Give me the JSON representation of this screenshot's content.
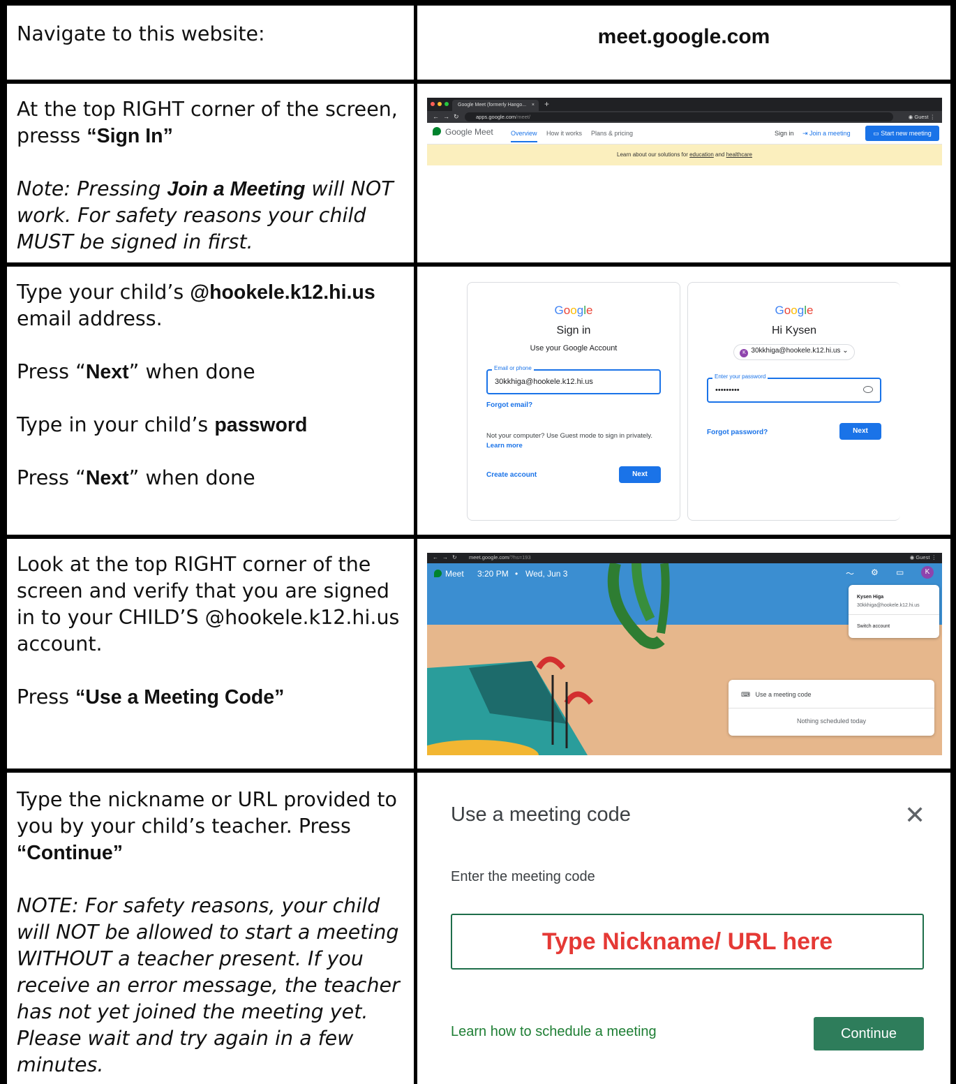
{
  "rows": [
    {
      "left": {
        "line1": "Navigate to this website:"
      },
      "right": {
        "url": "meet.google.com"
      }
    },
    {
      "left": {
        "p1_a": "At the top RIGHT corner of the screen, presss ",
        "p1_b": "“Sign In”",
        "note_a": "Note: Pressing ",
        "note_b": "Join a Meeting",
        "note_c": " will NOT work. For safety reasons your child MUST be signed in first."
      },
      "right": {
        "tab_title": "Google Meet (formerly Hango...",
        "tab_close": "×",
        "new_tab": "+",
        "url_host": "apps.google.com",
        "url_path": "/meet/",
        "guest": "Guest",
        "product": "Google Meet",
        "nav": [
          "Overview",
          "How it works",
          "Plans & pricing"
        ],
        "sign_in": "Sign in",
        "join": "Join a meeting",
        "start": "Start new meeting",
        "banner_a": "Learn about our solutions for ",
        "banner_b": "education",
        "banner_c": " and ",
        "banner_d": "healthcare"
      }
    },
    {
      "left": {
        "p1_a": "Type your child’s ",
        "p1_b": "@hookele.k12.hi.us",
        "p1_c": " email address.",
        "p2_a": "Press “",
        "p2_b": "Next",
        "p2_c": "” when done",
        "p3_a": "Type in your child’s ",
        "p3_b": "password",
        "p4_a": "Press “",
        "p4_b": "Next",
        "p4_c": "” when done"
      },
      "right": {
        "card1": {
          "logo": [
            "G",
            "o",
            "o",
            "g",
            "l",
            "e"
          ],
          "title": "Sign in",
          "subtitle": "Use your Google Account",
          "field_label": "Email or phone",
          "field_value": "30kkhiga@hookele.k12.hi.us",
          "forgot": "Forgot email?",
          "guest_note": "Not your computer? Use Guest mode to sign in privately.",
          "learn": "Learn more",
          "create": "Create account",
          "next": "Next"
        },
        "card2": {
          "logo": [
            "G",
            "o",
            "o",
            "g",
            "l",
            "e"
          ],
          "title": "Hi Kysen",
          "avatar": "K",
          "account": "30kkhiga@hookele.k12.hi.us",
          "chevron": "⌄",
          "field_label": "Enter your password",
          "field_value": "•••••••••",
          "forgot": "Forgot password?",
          "next": "Next"
        }
      }
    },
    {
      "left": {
        "p1": "Look at the top RIGHT corner of the screen and verify that you are signed in to your CHILD’S @hookele.k12.hi.us account.",
        "p2_a": "Press ",
        "p2_b": "“Use a Meeting Code”"
      },
      "right": {
        "url_host": "meet.google.com",
        "url_path": "/?hs=193",
        "guest": "Guest",
        "app": "Meet",
        "time": "3:20 PM",
        "sep": "•",
        "date": "Wed, Jun 3",
        "avatar": "K",
        "acct_name": "Kysen Higa",
        "acct_email": "30kkhiga@hookele.k12.hi.us",
        "switch": "Switch account",
        "use_code": "Use a meeting code",
        "nothing": "Nothing scheduled today"
      }
    },
    {
      "left": {
        "p1_a": "Type the nickname or URL provided to you by your child’s teacher. Press ",
        "p1_b": "“Continue”",
        "note": "NOTE: For safety reasons, your child will NOT be allowed to start a meeting WITHOUT a teacher present.  If you receive an error message, the teacher has not yet joined the meeting yet. Please wait and try again in a few minutes."
      },
      "right": {
        "title": "Use a meeting code",
        "close": "✕",
        "prompt": "Enter the meeting code",
        "input": "Type Nickname/ URL here",
        "learn": "Learn how to schedule a meeting",
        "continue": "Continue"
      }
    }
  ],
  "colors": {
    "border": "#000000",
    "google_blue": "#1a73e8",
    "meet_green": "#2e7d5b",
    "input_red": "#e53935"
  }
}
